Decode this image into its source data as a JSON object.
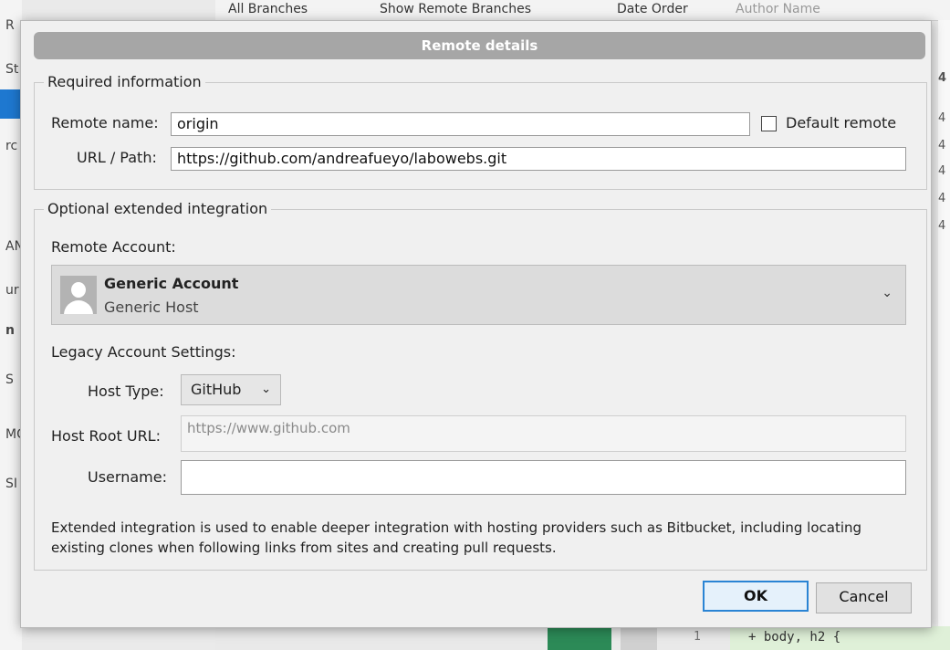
{
  "background": {
    "toolbar_items": [
      "All Branches",
      "Show Remote Branches",
      "Date Order",
      "Author Name"
    ],
    "left_chars": [
      "R",
      "St",
      "rc",
      "AN",
      "ur",
      "n",
      "S",
      "MC",
      "SI"
    ],
    "right_chars": [
      "4",
      "4",
      "4",
      "4",
      "4",
      "4"
    ],
    "code_line_number": "1",
    "code_text": "+ body, h2 {"
  },
  "dialog": {
    "title": "Remote details",
    "required": {
      "legend": "Required information",
      "remote_name_label": "Remote name:",
      "remote_name_value": "origin",
      "default_remote_label": "Default remote",
      "url_label": "URL / Path:",
      "url_value": "https://github.com/andreafueyo/labowebs.git"
    },
    "optional": {
      "legend": "Optional extended integration",
      "remote_account_label": "Remote Account:",
      "account_name": "Generic Account",
      "account_host": "Generic Host",
      "legacy_label": "Legacy Account Settings:",
      "host_type_label": "Host Type:",
      "host_type_value": "GitHub",
      "host_root_label": "Host Root URL:",
      "host_root_placeholder": "https://www.github.com",
      "username_label": "Username:",
      "username_value": "",
      "note": "Extended integration is used to enable deeper integration with hosting providers such as Bitbucket, including locating existing clones when following links from sites and creating pull requests."
    },
    "buttons": {
      "ok": "OK",
      "cancel": "Cancel"
    }
  }
}
